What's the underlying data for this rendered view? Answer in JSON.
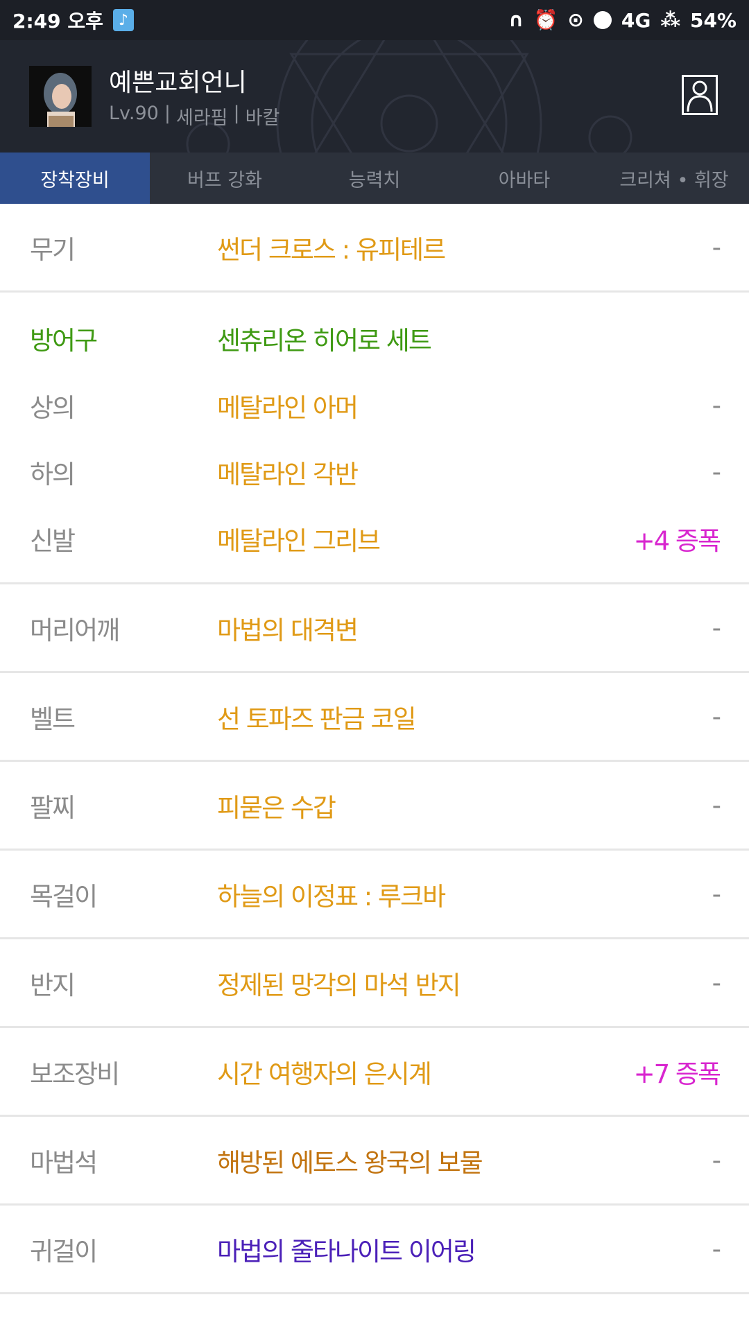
{
  "status_bar": {
    "time": "2:49 오후",
    "network": "4G",
    "battery": "54%"
  },
  "header": {
    "name": "예쁜교회언니",
    "level": "Lv.90",
    "class": "세라핌",
    "server": "바칼"
  },
  "tabs": [
    {
      "label": "장착장비",
      "active": true
    },
    {
      "label": "버프 강화",
      "active": false
    },
    {
      "label": "능력치",
      "active": false
    },
    {
      "label": "아바타",
      "active": false
    },
    {
      "label": "크리쳐 • 휘장",
      "active": false
    }
  ],
  "equipment": {
    "weapon": {
      "slot": "무기",
      "item": "썬더 크로스 : 유피테르",
      "amp": "-"
    },
    "armor": {
      "slot": "방어구",
      "set_name": "센츄리온 히어로 세트",
      "pieces": [
        {
          "slot": "상의",
          "item": "메탈라인 아머",
          "amp": "-"
        },
        {
          "slot": "하의",
          "item": "메탈라인 각반",
          "amp": "-"
        },
        {
          "slot": "신발",
          "item": "메탈라인 그리브",
          "amp": "+4 증폭"
        }
      ]
    },
    "rows": [
      {
        "slot": "머리어깨",
        "item": "마법의 대격변",
        "amp": "-"
      },
      {
        "slot": "벨트",
        "item": "선 토파즈 판금 코일",
        "amp": "-"
      },
      {
        "slot": "팔찌",
        "item": "피묻은 수갑",
        "amp": "-"
      },
      {
        "slot": "목걸이",
        "item": "하늘의 이정표 : 루크바",
        "amp": "-"
      },
      {
        "slot": "반지",
        "item": "정제된 망각의 마석 반지",
        "amp": "-"
      },
      {
        "slot": "보조장비",
        "item": "시간 여행자의 은시계",
        "amp": "+7 증폭"
      },
      {
        "slot": "마법석",
        "item": "해방된 에토스 왕국의 보물",
        "amp": "-"
      },
      {
        "slot": "귀걸이",
        "item": "마법의 줄타나이트 이어링",
        "amp": "-"
      }
    ]
  },
  "colors": {
    "legendary": "#e09a16",
    "epic": "#c27410",
    "rare": "#4b20b8",
    "set": "#3f9a13",
    "amplified": "#d826cf",
    "active_tab": "#2f4f8e"
  }
}
